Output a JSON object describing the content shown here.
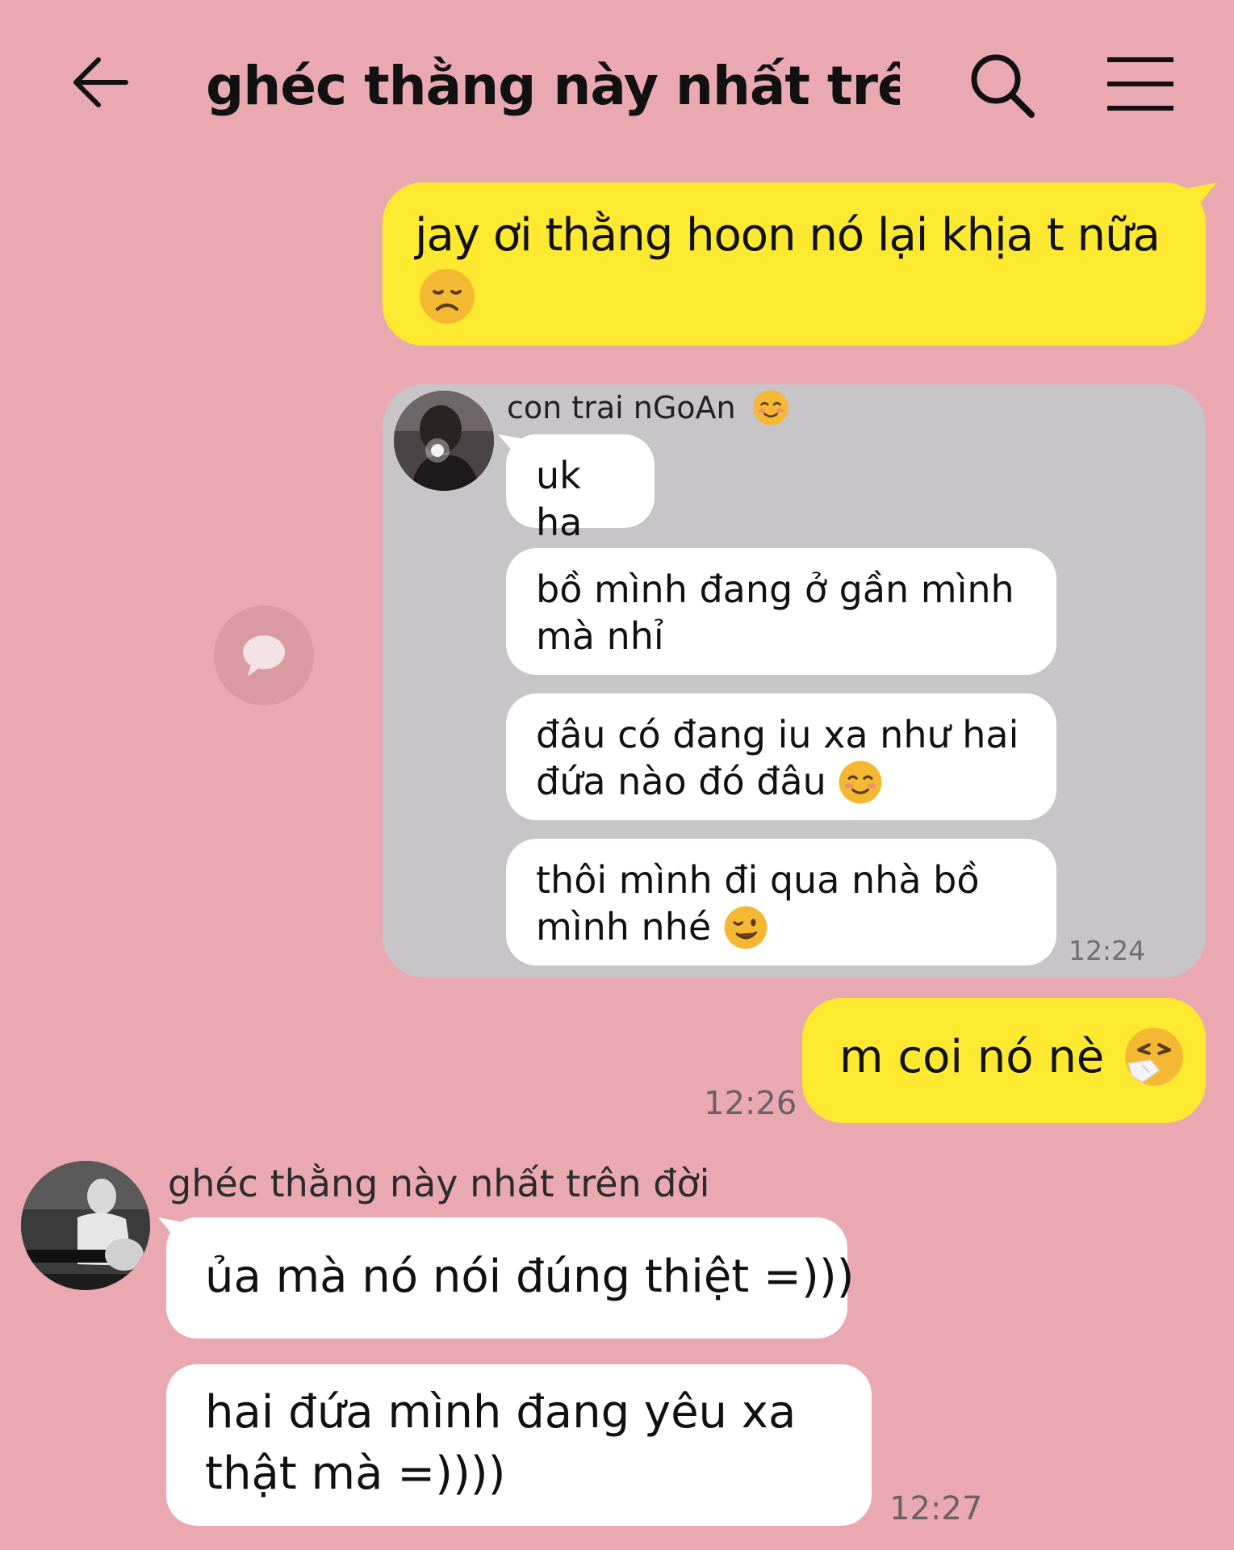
{
  "header": {
    "back_icon": "back-arrow-icon",
    "title": "ghéc thằng này nhất trê...",
    "search_icon": "search-icon",
    "menu_icon": "hamburger-menu-icon"
  },
  "colors": {
    "background": "#eaa9b1",
    "outgoing_bubble": "#fde92f",
    "incoming_bubble": "#ffffff",
    "forwarded_card": "#c7c5c7"
  },
  "messages": {
    "m1": {
      "text": "jay ơi thằng hoon nó lại khịa t nữa",
      "emoji": "disappointed-face-emoji"
    },
    "forwarded": {
      "sender": "con trai nGoAn",
      "sender_emoji": "smiling-face-emoji",
      "bubbles": [
        {
          "text": "uk ha"
        },
        {
          "text": "bồ mình đang ở gần mình mà nhỉ"
        },
        {
          "text": "đâu có đang iu xa như hai đứa nào đó đâu",
          "emoji": "smiling-face-emoji"
        },
        {
          "text": "thôi mình đi qua nhà bồ mình nhé",
          "emoji": "winking-face-emoji"
        }
      ],
      "time": "12:24",
      "share_icon": "chat-bubble-share-icon"
    },
    "m2": {
      "text": "m coi nó nè",
      "emoji": "sneezing-face-emoji",
      "time": "12:26"
    },
    "received": {
      "sender": "ghéc thằng này nhất trên đời",
      "m3": "ủa mà nó nói đúng thiệt =)))",
      "m4": "hai đứa mình đang yêu xa thật mà =))))",
      "time": "12:27"
    }
  }
}
